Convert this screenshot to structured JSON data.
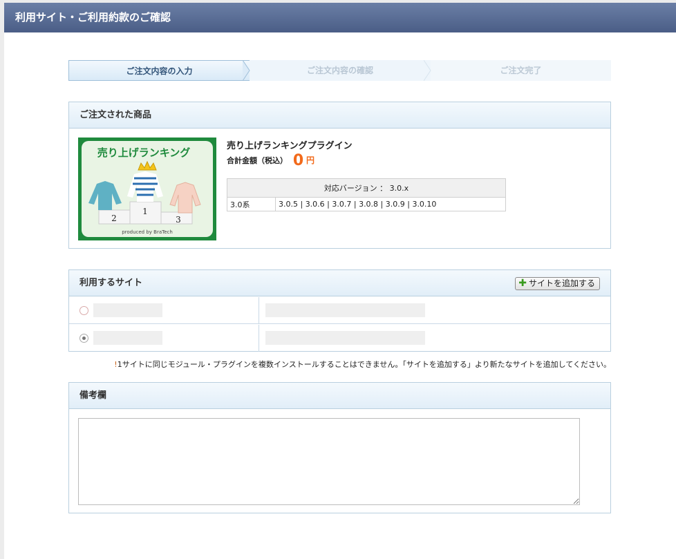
{
  "window": {
    "title": "利用サイト・ご利用約款のご確認"
  },
  "steps": [
    {
      "label": "ご注文内容の入力"
    },
    {
      "label": "ご注文内容の確認"
    },
    {
      "label": "ご注文完了"
    }
  ],
  "order": {
    "heading": "ご注文された商品",
    "image_caption": "売り上げランキング",
    "image_podium": [
      "2",
      "1",
      "3"
    ],
    "image_credit": "produced by BraTech",
    "product_name": "売り上げランキングプラグイン",
    "total_label": "合計金額（税込）",
    "total_value": "0",
    "total_unit": "円",
    "version_header": "対応バージョン ： 3.0.x",
    "version_series": "3.0系",
    "version_list": "3.0.5 | 3.0.6 | 3.0.7 | 3.0.8 | 3.0.9 | 3.0.10"
  },
  "sites": {
    "heading": "利用するサイト",
    "add_button": "サイトを追加する",
    "rows": [
      {
        "selected": false
      },
      {
        "selected": true
      }
    ],
    "notice_mark": "!",
    "notice": "1サイトに同じモジュール・プラグインを複数インストールすることはできません。「サイトを追加する」より新たなサイトを追加してください。"
  },
  "remarks": {
    "heading": "備考欄",
    "value": ""
  }
}
